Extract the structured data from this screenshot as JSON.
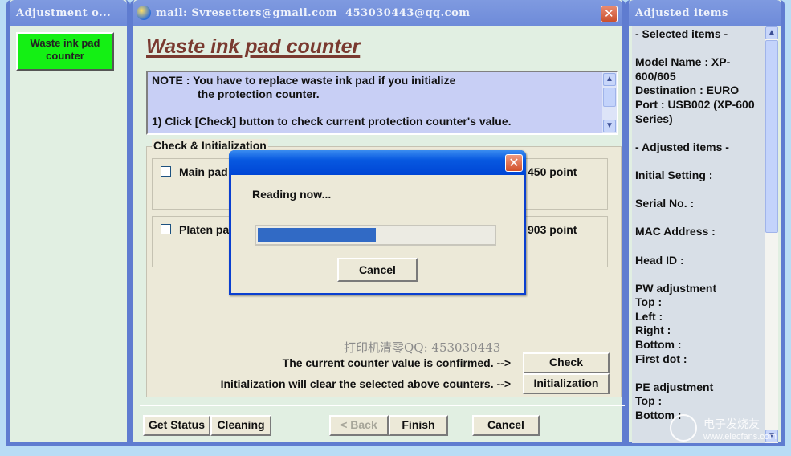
{
  "left_panel": {
    "title": "Adjustment o...",
    "waste_ink_button": "Waste ink pad counter",
    "active_color": "#14f014"
  },
  "main_window": {
    "title": "mail: Svresetters@gmail.com  453030443@qq.com",
    "close_label": "✕",
    "heading": "Waste ink pad counter",
    "note": {
      "line1": "NOTE : You have to replace waste ink pad if you initialize",
      "line2": "the protection counter.",
      "line3": "",
      "line4": "1) Click [Check] button to check current protection counter's value."
    },
    "group_label": "Check & Initialization",
    "pads": [
      {
        "label": "Main pad",
        "value": "450 point",
        "checked": false
      },
      {
        "label": "Platen pa",
        "value": "903 point",
        "checked": false
      }
    ],
    "qq_note": "打印机清零QQ: 453030443",
    "check_text": "The current counter value is confirmed. -->",
    "check_button": "Check",
    "init_text": "Initialization will clear the selected above counters. -->",
    "init_button": "Initialization",
    "bottom_buttons": {
      "get_status": "Get Status",
      "cleaning": "Cleaning",
      "back": "< Back",
      "finish": "Finish",
      "cancel": "Cancel"
    }
  },
  "right_panel": {
    "title": "Adjusted items",
    "lines": [
      "- Selected items -",
      "",
      "Model Name : XP-",
      "600/605",
      "Destination : EURO",
      "Port : USB002 (XP-600",
      "Series)",
      "",
      "- Adjusted items -",
      "",
      "Initial Setting :",
      "",
      "Serial No. :",
      "",
      "MAC Address :",
      "",
      "Head ID :",
      "",
      "PW adjustment",
      "Top :",
      "Left :",
      "Right :",
      "Bottom :",
      "First dot :",
      "",
      "PE adjustment",
      "Top :",
      "Bottom :"
    ]
  },
  "dialog": {
    "message": "Reading now...",
    "progress_percent": 50,
    "cancel_button": "Cancel",
    "close_label": "✕"
  },
  "watermark": {
    "text": "电子发烧友",
    "url": "www.elecfans.com"
  }
}
